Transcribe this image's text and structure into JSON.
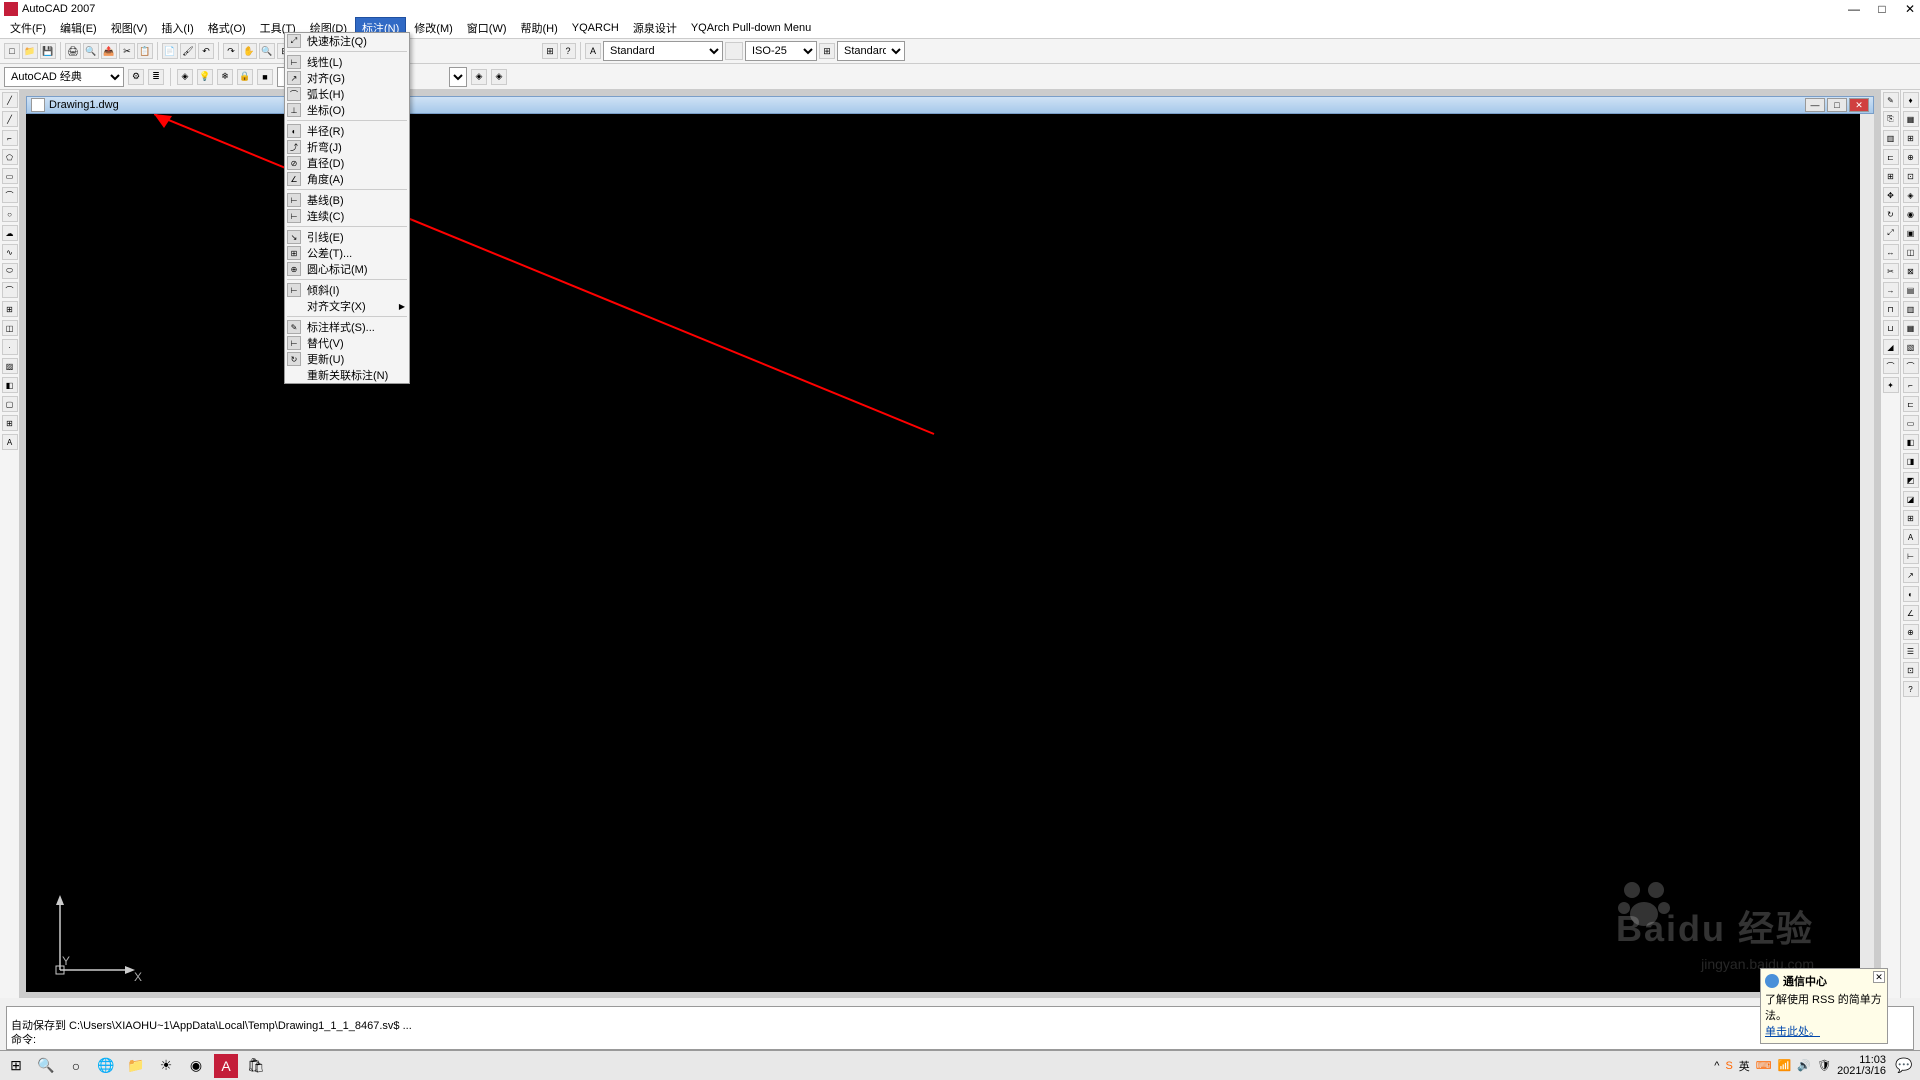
{
  "title": "AutoCAD 2007",
  "menubar": [
    "文件(F)",
    "编辑(E)",
    "视图(V)",
    "插入(I)",
    "格式(O)",
    "工具(T)",
    "绘图(D)",
    "标注(N)",
    "修改(M)",
    "窗口(W)",
    "帮助(H)",
    "YQARCH",
    "源泉设计",
    "YQArch Pull-down Menu"
  ],
  "activeMenuIndex": 7,
  "workspace": "AutoCAD 经典",
  "styleSelect1": "Standard",
  "styleSelect2": "ISO-25",
  "styleSelect3": "Standard",
  "docTitle": "Drawing1.dwg",
  "dropdown": {
    "groups": [
      [
        {
          "label": "快速标注(Q)",
          "icon": "⤢"
        }
      ],
      [
        {
          "label": "线性(L)",
          "icon": "⊢"
        },
        {
          "label": "对齐(G)",
          "icon": "↗"
        },
        {
          "label": "弧长(H)",
          "icon": "⌒"
        },
        {
          "label": "坐标(O)",
          "icon": "⊥"
        }
      ],
      [
        {
          "label": "半径(R)",
          "icon": "◐"
        },
        {
          "label": "折弯(J)",
          "icon": "⤴"
        },
        {
          "label": "直径(D)",
          "icon": "⊘"
        },
        {
          "label": "角度(A)",
          "icon": "∠"
        }
      ],
      [
        {
          "label": "基线(B)",
          "icon": "⊢"
        },
        {
          "label": "连续(C)",
          "icon": "⊢"
        }
      ],
      [
        {
          "label": "引线(E)",
          "icon": "↘"
        },
        {
          "label": "公差(T)...",
          "icon": "⊞"
        },
        {
          "label": "圆心标记(M)",
          "icon": "⊕"
        }
      ],
      [
        {
          "label": "倾斜(I)",
          "icon": "⊢"
        },
        {
          "label": "对齐文字(X)",
          "icon": "",
          "arrow": true
        }
      ],
      [
        {
          "label": "标注样式(S)...",
          "icon": "✎"
        },
        {
          "label": "替代(V)",
          "icon": "⊢"
        },
        {
          "label": "更新(U)",
          "icon": "↻"
        },
        {
          "label": "重新关联标注(N)",
          "icon": ""
        }
      ]
    ]
  },
  "cmd": {
    "line1": "自动保存到  C:\\Users\\XIAOHU~1\\AppData\\Local\\Temp\\Drawing1_1_1_8467.sv$ ...",
    "line2": "命令:"
  },
  "axis": {
    "x": "X",
    "y": "Y"
  },
  "tooltip": {
    "title": "通信中心",
    "text": "了解使用 RSS 的简单方法。",
    "link": "单击此处。"
  },
  "tray": {
    "lang": "英",
    "time": "11:03",
    "date": "2021/3/16"
  },
  "watermark": "Baidu 经验",
  "watermark_sub": "jingyan.baidu.com"
}
